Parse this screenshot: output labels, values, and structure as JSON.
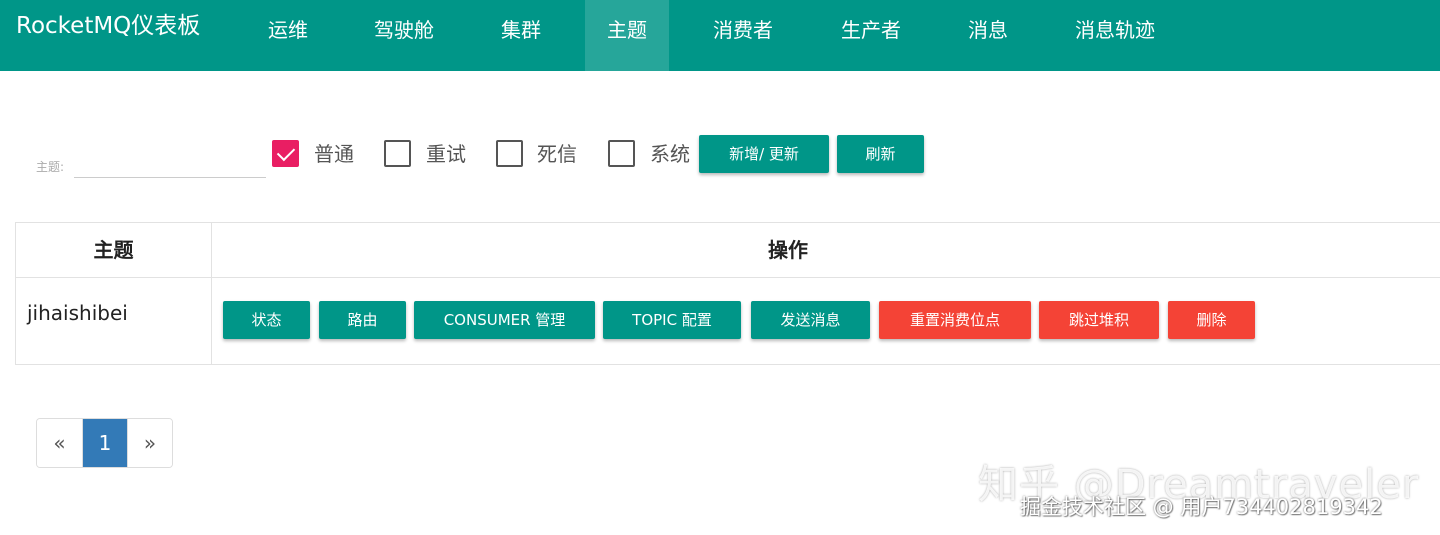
{
  "brand": "RocketMQ仪表板",
  "nav": [
    "运维",
    "驾驶舱",
    "集群",
    "主题",
    "消费者",
    "生产者",
    "消息",
    "消息轨迹"
  ],
  "active_nav": "主题",
  "filter": {
    "topic_label": "主题:",
    "topic_value": "",
    "checkboxes": [
      {
        "label": "普通",
        "checked": true
      },
      {
        "label": "重试",
        "checked": false
      },
      {
        "label": "死信",
        "checked": false
      },
      {
        "label": "系统",
        "checked": false
      }
    ],
    "add_update_label": "新增/ 更新",
    "refresh_label": "刷新"
  },
  "table": {
    "headers": [
      "主题",
      "操作"
    ],
    "rows": [
      {
        "topic": "jihaishibei",
        "actions": [
          "状态",
          "路由",
          "CONSUMER 管理",
          "TOPIC 配置",
          "发送消息",
          "重置消费位点",
          "跳过堆积",
          "删除"
        ]
      }
    ]
  },
  "pagination": {
    "prev": "«",
    "current": "1",
    "next": "»"
  },
  "watermark": {
    "line1": "知乎 @Dreamtraveler",
    "line2": "掘金技术社区 @ 用户7344028​19342"
  },
  "colors": {
    "primary": "#009688",
    "danger": "#f44336",
    "checkbox_checked": "#e91e63",
    "page_active": "#337ab7"
  }
}
